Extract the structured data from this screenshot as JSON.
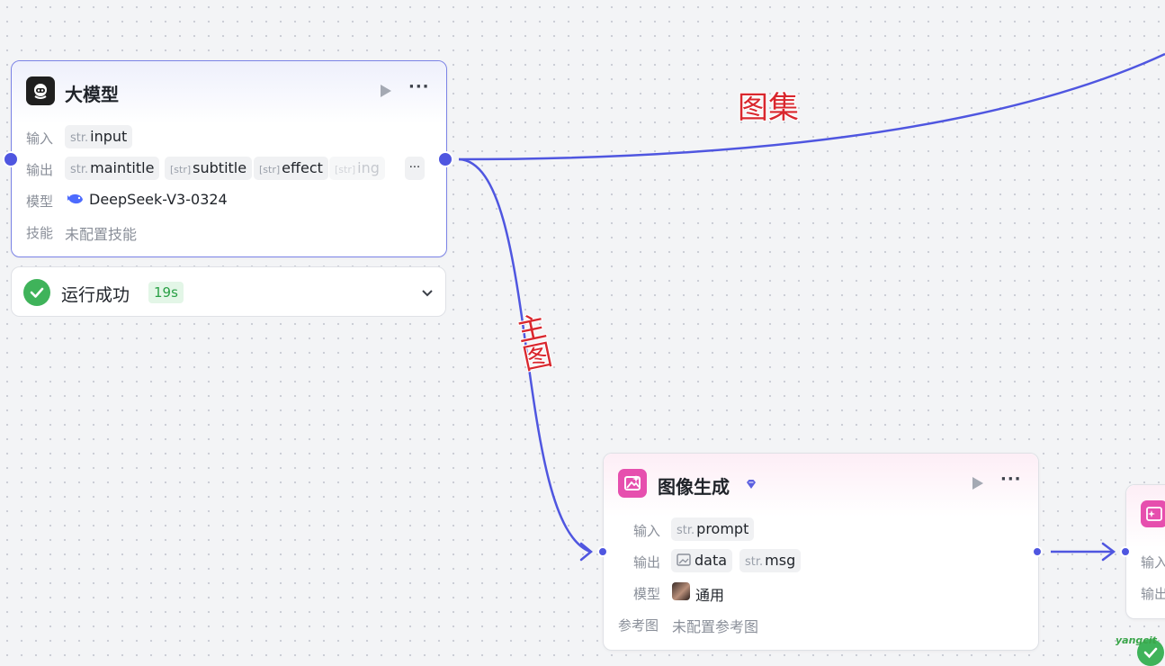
{
  "colors": {
    "edge": "#4f56e0",
    "accent_purple": "#5b5fe0",
    "llm_icon": "#1f1f1f",
    "image_icon": "#e64fae",
    "success": "#3fb35a",
    "edge_label": "#d9272e"
  },
  "edge_labels": {
    "gallery": "图集",
    "main_image": "主图"
  },
  "llm_node": {
    "title": "大模型",
    "icon": "llm-robot-icon",
    "input_label": "输入",
    "inputs": [
      {
        "type": "str.",
        "name": "input"
      }
    ],
    "output_label": "输出",
    "outputs": [
      {
        "type": "str.",
        "name": "maintitle"
      },
      {
        "type": "[str]",
        "name": "subtitle"
      },
      {
        "type": "[str]",
        "name": "effect"
      },
      {
        "type": "[str]",
        "name": "ing"
      }
    ],
    "more_outputs": "···",
    "model_label": "模型",
    "model_value": "DeepSeek-V3-0324",
    "skill_label": "技能",
    "skill_value": "未配置技能"
  },
  "run_status": {
    "text": "运行成功",
    "duration": "19s"
  },
  "image_node": {
    "title": "图像生成",
    "icon": "image-generate-icon",
    "input_label": "输入",
    "inputs": [
      {
        "type": "str.",
        "name": "prompt"
      }
    ],
    "output_label": "输出",
    "outputs": [
      {
        "type": "image",
        "name": "data"
      },
      {
        "type": "str.",
        "name": "msg"
      }
    ],
    "model_label": "模型",
    "model_value": "通用",
    "ref_label": "参考图",
    "ref_value": "未配置参考图"
  },
  "partial_node": {
    "input_label": "输入",
    "output_label": "输出"
  },
  "watermark": "yangcit"
}
